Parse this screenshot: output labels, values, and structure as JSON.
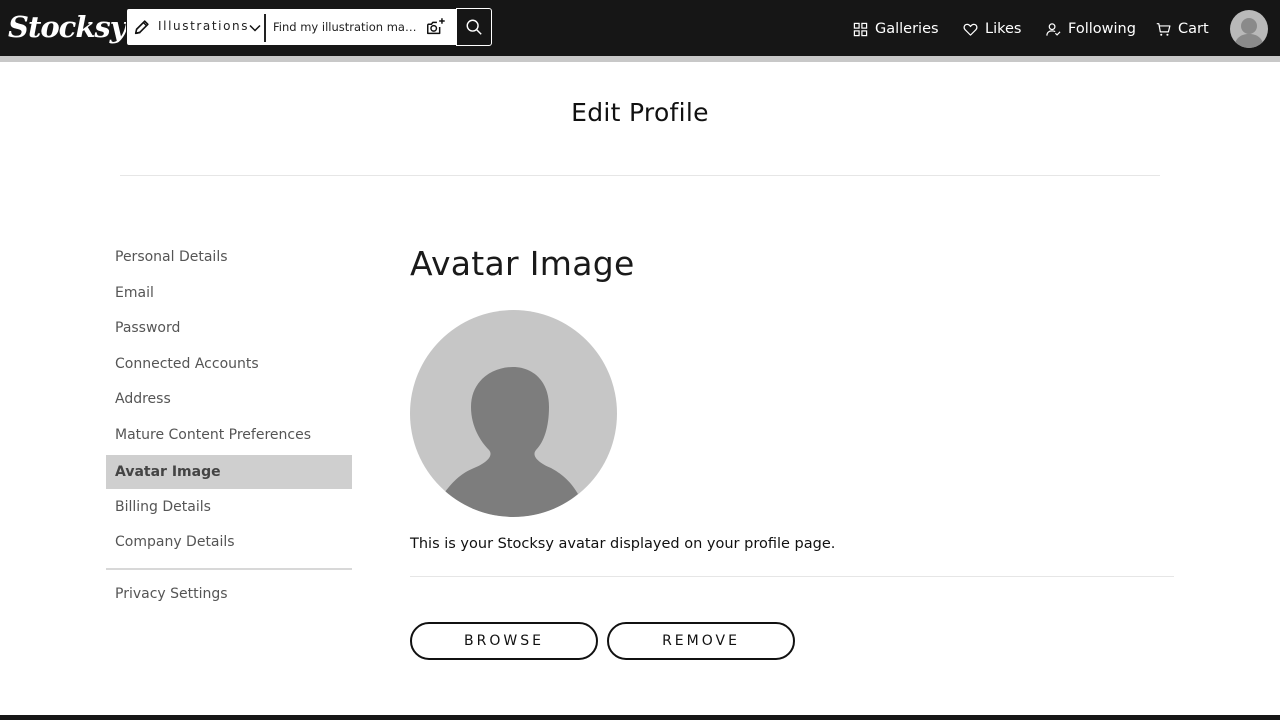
{
  "brand": {
    "logo_text": "Stocksy"
  },
  "search": {
    "category_label": "Illustrations",
    "placeholder": "Find my illustration masterpiece"
  },
  "nav": {
    "galleries": "Galleries",
    "likes": "Likes",
    "following": "Following",
    "cart": "Cart"
  },
  "page": {
    "title": "Edit Profile"
  },
  "sidebar": {
    "items": [
      {
        "label": "Personal Details",
        "active": false
      },
      {
        "label": "Email",
        "active": false
      },
      {
        "label": "Password",
        "active": false
      },
      {
        "label": "Connected Accounts",
        "active": false
      },
      {
        "label": "Address",
        "active": false
      },
      {
        "label": "Mature Content Preferences",
        "active": false
      },
      {
        "label": "Avatar Image",
        "active": true
      },
      {
        "label": "Billing Details",
        "active": false
      },
      {
        "label": "Company Details",
        "active": false
      }
    ],
    "secondary_items": [
      {
        "label": "Privacy Settings"
      }
    ]
  },
  "main": {
    "section_title": "Avatar Image",
    "description": "This is your Stocksy avatar displayed on your profile page.",
    "browse_label": "BROWSE",
    "remove_label": "REMOVE"
  },
  "colors": {
    "topbar": "#161616",
    "active_sidebar_bg": "#cfcfcf",
    "avatar_bg": "#c6c6c6",
    "avatar_silhouette": "#7d7d7d"
  }
}
